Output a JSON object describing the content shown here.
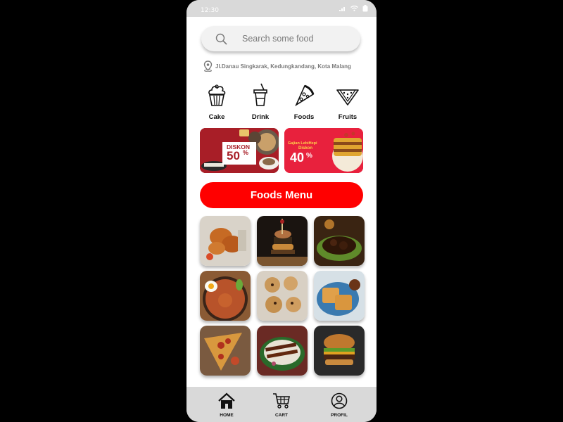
{
  "status_bar": {
    "time": "12:30"
  },
  "search": {
    "placeholder": "Search some food"
  },
  "location": {
    "address": "Jl.Danau Singkarak, Kedungkandang, Kota Malang"
  },
  "categories": [
    {
      "label": "Cake",
      "icon": "cupcake-icon"
    },
    {
      "label": "Drink",
      "icon": "drink-cup-icon"
    },
    {
      "label": "Foods",
      "icon": "pizza-slice-icon"
    },
    {
      "label": "Fruits",
      "icon": "watermelon-icon"
    }
  ],
  "banners": [
    {
      "line1": "DISKON",
      "value": "50",
      "unit": "%"
    },
    {
      "line1": "Gajian LebiHepi",
      "line2": "Diskon",
      "value": "40",
      "unit": "%"
    }
  ],
  "menu": {
    "title": "Foods Menu"
  },
  "foods": [
    "fried-chicken",
    "burger-tower",
    "beef-rendang",
    "fried-noodles",
    "cookies",
    "waffles",
    "pizza",
    "satay",
    "cheeseburger"
  ],
  "nav": [
    {
      "label": "HOME",
      "icon": "home-icon"
    },
    {
      "label": "CART",
      "icon": "cart-icon"
    },
    {
      "label": "PROFIL",
      "icon": "profile-icon"
    }
  ],
  "colors": {
    "accent": "#ff0000",
    "bar": "#d9d9d9",
    "banner2": "#e8213d"
  }
}
